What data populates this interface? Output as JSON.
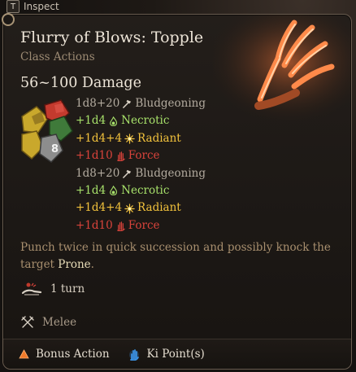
{
  "header": {
    "key": "T",
    "label": "Inspect"
  },
  "spell": {
    "title": "Flurry of Blows: Topple",
    "category": "Class Actions",
    "damage_total": "56~100 Damage"
  },
  "damage_rows": [
    {
      "dice": "1d8+20",
      "type": "Bludgeoning",
      "icon": "hammer-icon",
      "color": "#b3ab9f"
    },
    {
      "dice": "+1d4",
      "type": "Necrotic",
      "icon": "necrotic-flame-icon",
      "color": "#a7e06a"
    },
    {
      "dice": "+1d4+4",
      "type": "Radiant",
      "icon": "radiant-sun-icon",
      "color": "#f2c23c"
    },
    {
      "dice": "+1d10",
      "type": "Force",
      "icon": "force-hand-icon",
      "color": "#d9433b"
    },
    {
      "dice": "1d8+20",
      "type": "Bludgeoning",
      "icon": "hammer-icon",
      "color": "#b3ab9f"
    },
    {
      "dice": "+1d4",
      "type": "Necrotic",
      "icon": "necrotic-flame-icon",
      "color": "#a7e06a"
    },
    {
      "dice": "+1d4+4",
      "type": "Radiant",
      "icon": "radiant-sun-icon",
      "color": "#f2c23c"
    },
    {
      "dice": "+1d10",
      "type": "Force",
      "icon": "force-hand-icon",
      "color": "#d9433b"
    }
  ],
  "dice_icon": {
    "label": "8"
  },
  "description": {
    "text": "Punch twice in quick succession and possibly knock the target ",
    "keyword": "Prone",
    "suffix": "."
  },
  "duration": {
    "icon": "prone-figure-icon",
    "text": "1 turn"
  },
  "range": {
    "icon": "crossed-swords-icon",
    "text": "Melee"
  },
  "costs": [
    {
      "icon": "bonus-action-triangle-icon",
      "label": "Bonus Action",
      "color": "#f07a2a"
    },
    {
      "icon": "ki-point-icon",
      "label": "Ki Point(s)",
      "color": "#3a8fe0"
    }
  ]
}
